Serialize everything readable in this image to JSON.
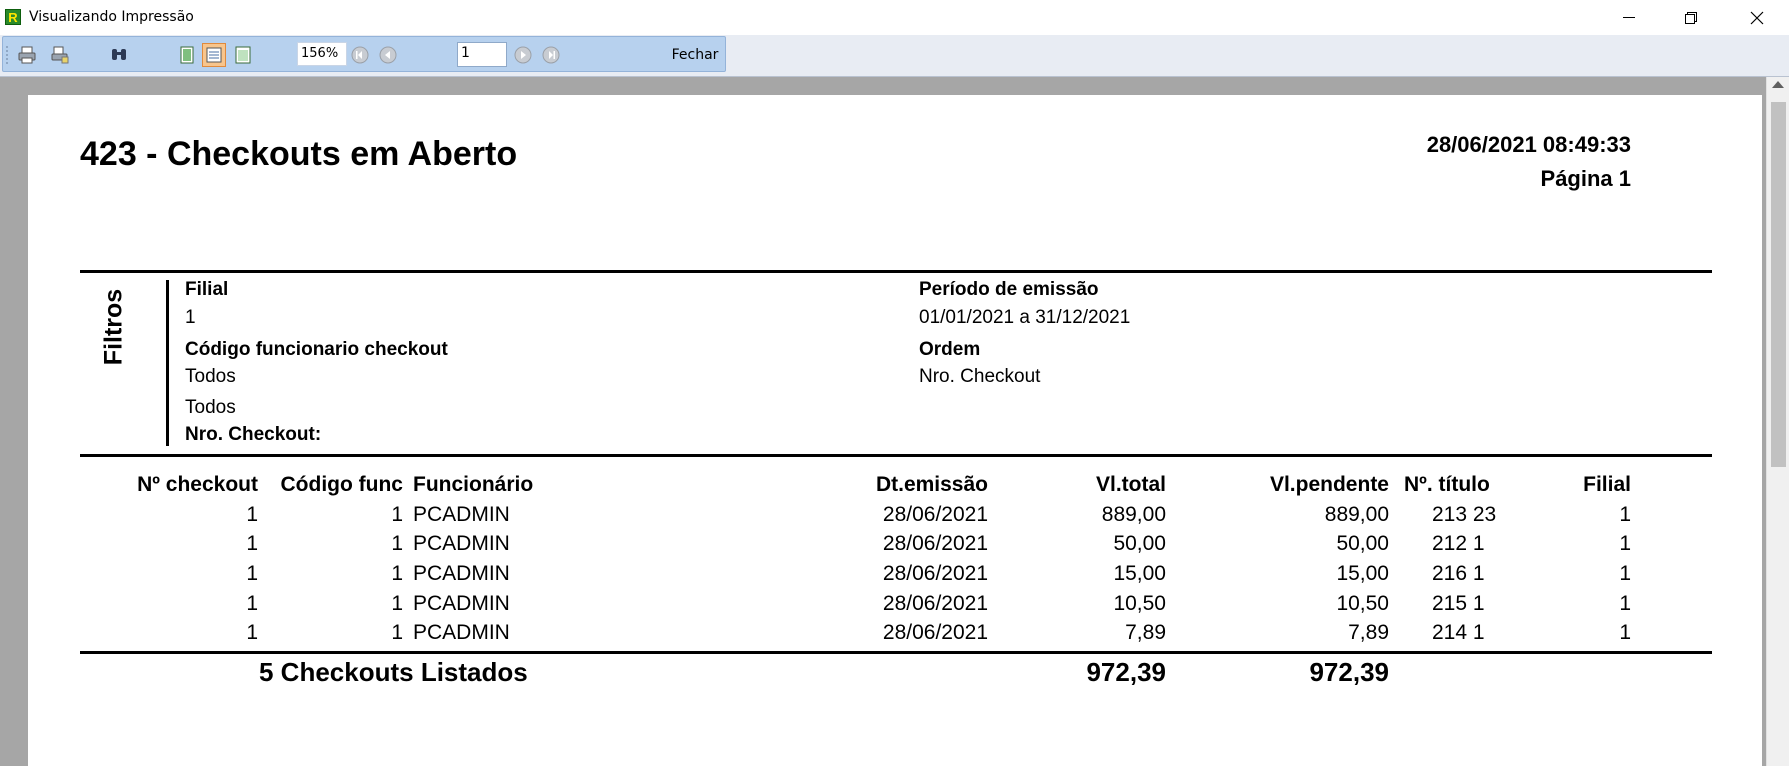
{
  "window": {
    "title": "Visualizando Impressão",
    "icon_letter": "R",
    "controls": [
      "minimize-icon",
      "maximize-icon",
      "close-icon"
    ]
  },
  "toolbar": {
    "zoom": "156%",
    "page_number": "1",
    "close_label": "Fechar",
    "icons": [
      "print-icon",
      "print-setup-icon",
      "find-icon",
      "single-page-icon",
      "page-width-icon",
      "two-pages-icon",
      "first-page-icon",
      "previous-page-icon",
      "next-page-icon",
      "last-page-icon"
    ]
  },
  "report": {
    "title": "423 - Checkouts em Aberto",
    "datetime": "28/06/2021 08:49:33",
    "page": "Página 1",
    "filters": {
      "label": "Filtros",
      "filial_label": "Filial",
      "filial_value": "1",
      "codigo_label": "Código funcionario checkout",
      "codigo_value1": "Todos",
      "codigo_value2": "Todos",
      "nro_checkout_label": "Nro. Checkout:",
      "periodo_label": "Período de emissão",
      "periodo_value": "01/01/2021 a 31/12/2021",
      "ordem_label": "Ordem",
      "ordem_value": "Nro. Checkout"
    },
    "columns": [
      "Nº checkout",
      "Código func",
      "Funcionário",
      "Dt.emissão",
      "Vl.total",
      "Vl.pendente",
      "Nº. título",
      "Filial"
    ],
    "rows": [
      [
        "1",
        "1",
        "PCADMIN",
        "28/06/2021",
        "889,00",
        "889,00",
        "213 23",
        "1"
      ],
      [
        "1",
        "1",
        "PCADMIN",
        "28/06/2021",
        "50,00",
        "50,00",
        "212 1",
        "1"
      ],
      [
        "1",
        "1",
        "PCADMIN",
        "28/06/2021",
        "15,00",
        "15,00",
        "216 1",
        "1"
      ],
      [
        "1",
        "1",
        "PCADMIN",
        "28/06/2021",
        "10,50",
        "10,50",
        "215 1",
        "1"
      ],
      [
        "1",
        "1",
        "PCADMIN",
        "28/06/2021",
        "7,89",
        "7,89",
        "214 1",
        "1"
      ]
    ],
    "footer": {
      "label": "5 Checkouts Listados",
      "total": "972,39",
      "pendente": "972,39"
    }
  }
}
